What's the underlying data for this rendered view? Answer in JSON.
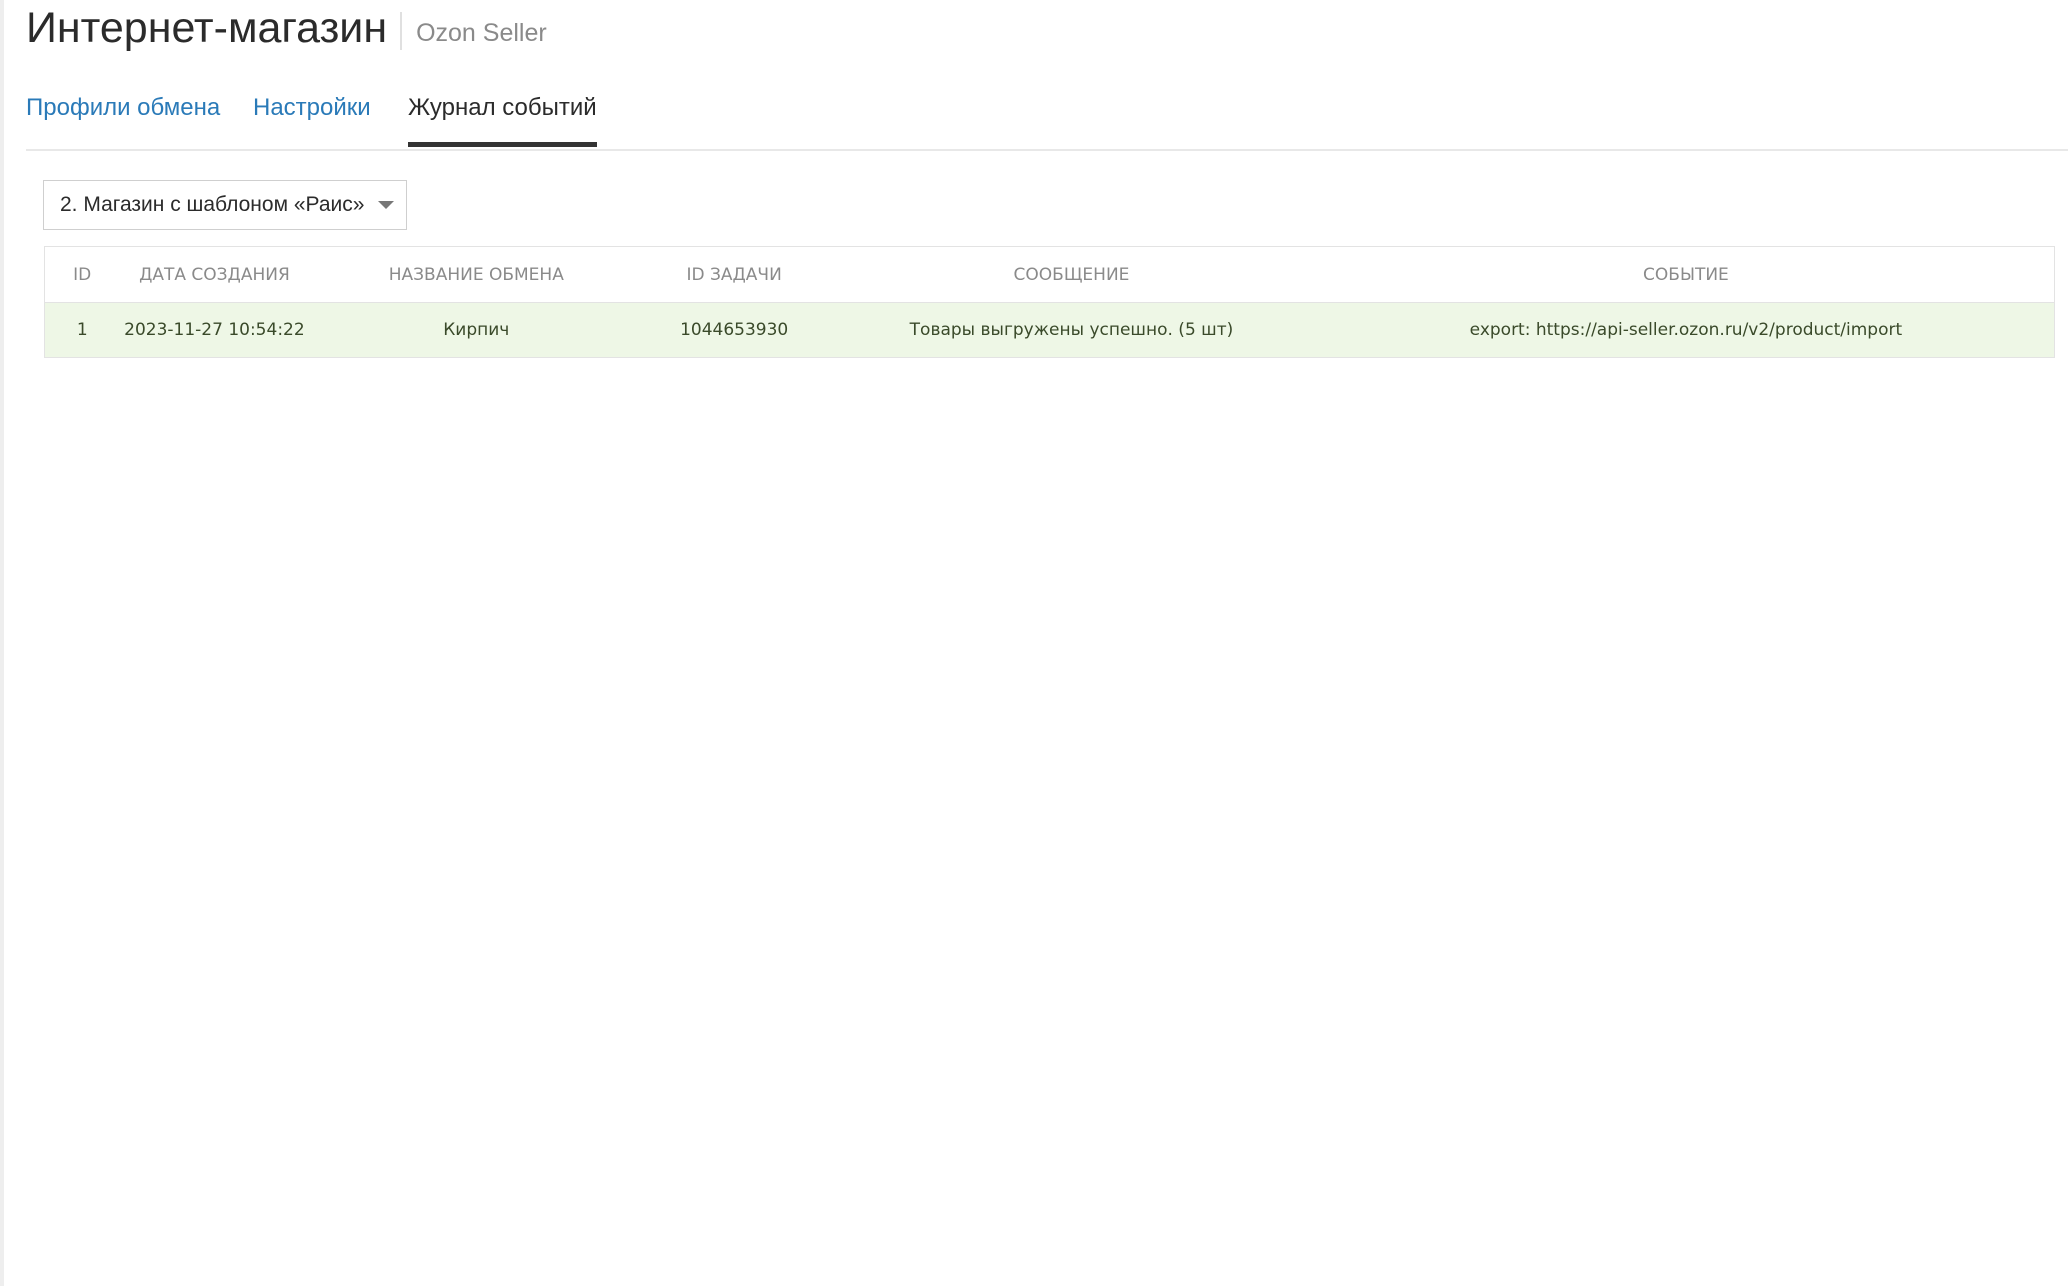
{
  "header": {
    "title": "Интернет-магазин",
    "subtitle": "Ozon Seller"
  },
  "tabs": [
    {
      "label": "Профили обмена",
      "active": false
    },
    {
      "label": "Настройки",
      "active": false
    },
    {
      "label": "Журнал событий",
      "active": true
    }
  ],
  "profile_select": {
    "value": "2. Магазин с шаблоном «Раис»"
  },
  "table": {
    "columns": [
      "ID",
      "ДАТА СОЗДАНИЯ",
      "НАЗВАНИЕ ОБМЕНА",
      "ID ЗАДАЧИ",
      "СООБЩЕНИЕ",
      "СОБЫТИЕ"
    ],
    "rows": [
      {
        "id": "1",
        "created": "2023-11-27 10:54:22",
        "exchange_name": "Кирпич",
        "task_id": "1044653930",
        "message": "Товары выгружены успешно. (5 шт)",
        "event": "export: https://api-seller.ozon.ru/v2/product/import",
        "status": "success"
      }
    ]
  },
  "colors": {
    "link": "#2a7ab8",
    "success_row": "#eef7e6",
    "active_tab_underline": "#333333"
  }
}
